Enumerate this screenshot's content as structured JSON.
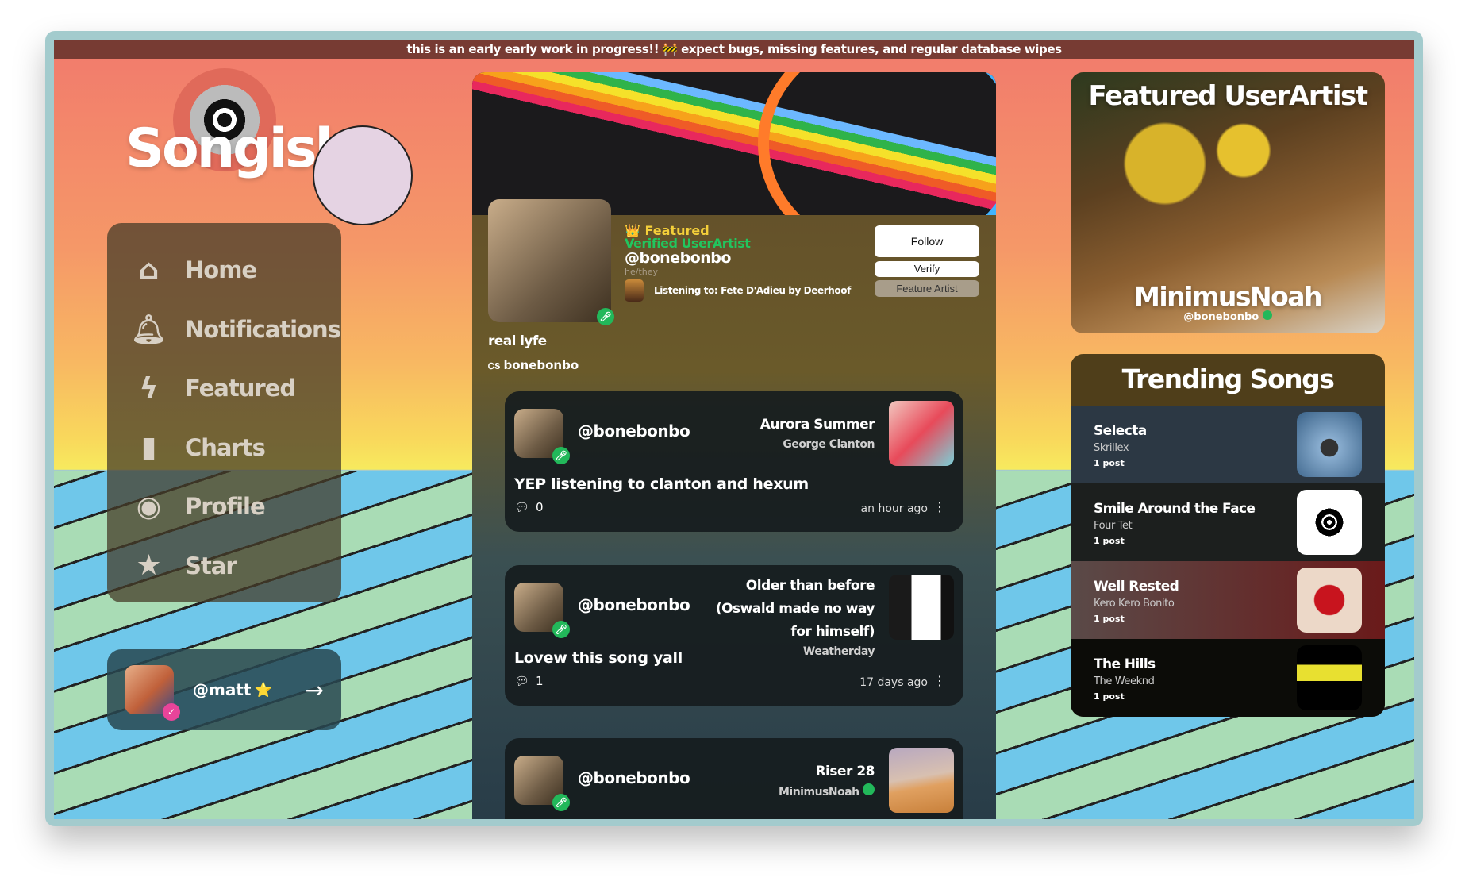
{
  "banner": "this is an early early work in progress!! 🚧 expect bugs, missing features, and regular database wipes",
  "logo": "Songish",
  "nav": [
    {
      "label": "Home",
      "icon": "home-icon"
    },
    {
      "label": "Notifications",
      "icon": "bell-icon"
    },
    {
      "label": "Featured",
      "icon": "lightning-icon"
    },
    {
      "label": "Charts",
      "icon": "bar-chart-icon"
    },
    {
      "label": "Profile",
      "icon": "user-circle-icon"
    },
    {
      "label": "Star",
      "icon": "star-icon"
    }
  ],
  "current_user": {
    "handle": "@matt",
    "emoji": "⭐"
  },
  "profile": {
    "featured": "👑 Featured",
    "verified": "Verified UserArtist",
    "handle": "@bonebonbo",
    "pronouns": "he/they",
    "listening": "Listening to: Fete D'Adieu by Deerhoof",
    "name": "real lyfe",
    "lastfm": "bonebonbo",
    "lastfm_icon": "ᏟՏ",
    "follow": "Follow",
    "verify": "Verify",
    "feature": "Feature Artist"
  },
  "posts": [
    {
      "handle": "@bonebonbo",
      "song": "Aurora Summer",
      "artist": "George Clanton",
      "text": "YEP listening to clanton and hexum",
      "comments": "0",
      "time": "an hour ago"
    },
    {
      "handle": "@bonebonbo",
      "song": "Older than before (Oswald made no way for himself)",
      "artist": "Weatherday",
      "text": "Lovew this song yall",
      "comments": "1",
      "time": "17 days ago"
    },
    {
      "handle": "@bonebonbo",
      "song": "Riser 28",
      "artist": "MinimusNoah",
      "text": "",
      "comments": "",
      "time": ""
    }
  ],
  "featured_artist": {
    "title": "Featured UserArtist",
    "name": "MinimusNoah",
    "handle": "@bonebonbo"
  },
  "trending": {
    "title": "Trending Songs",
    "songs": [
      {
        "title": "Selecta",
        "artist": "Skrillex",
        "posts": "1 post"
      },
      {
        "title": "Smile Around the Face",
        "artist": "Four Tet",
        "posts": "1 post"
      },
      {
        "title": "Well Rested",
        "artist": "Kero Kero Bonito",
        "posts": "1 post"
      },
      {
        "title": "The Hills",
        "artist": "The Weeknd",
        "posts": "1 post"
      }
    ]
  },
  "colors": {
    "banner": "#773b33",
    "verified": "#22c55e",
    "featured": "#f4cf3a"
  }
}
